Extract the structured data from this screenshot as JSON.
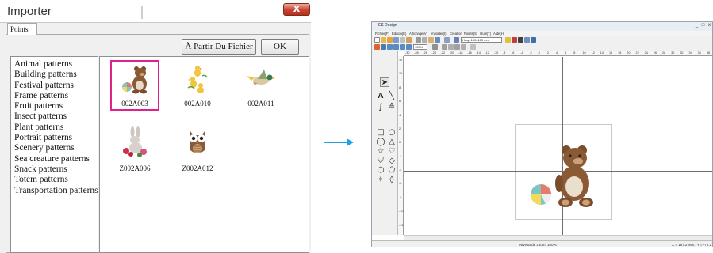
{
  "dialog": {
    "title": "Importer",
    "close_label": "X",
    "tab_label": "Points",
    "from_file_button": "À Partir Du Fichier",
    "ok_button": "OK",
    "categories": [
      "Animal patterns",
      "Building patterns",
      "Festival patterns",
      "Frame patterns",
      "Fruit patterns",
      "Insect patterns",
      "Plant patterns",
      "Portrait patterns",
      "Scenery patterns",
      "Sea creature patterns",
      "Snack patterns",
      "Totem patterns",
      "Transportation patterns"
    ],
    "selected_category": "Animal patterns",
    "patterns": [
      {
        "code": "002A003",
        "icon": "bear-with-ball-icon",
        "selected": true
      },
      {
        "code": "002A010",
        "icon": "ducklings-icon",
        "selected": false
      },
      {
        "code": "002A011",
        "icon": "flying-duck-icon",
        "selected": false
      },
      {
        "code": "Z002A006",
        "icon": "rabbit-with-flowers-icon",
        "selected": false
      },
      {
        "code": "Z002A012",
        "icon": "owl-icon",
        "selected": false
      }
    ],
    "selection_color": "#e0208c"
  },
  "arrow": {
    "icon": "right-arrow-icon",
    "color": "#1aa3e8"
  },
  "app": {
    "title": "ES Design",
    "window_controls": [
      "_",
      "□",
      "x"
    ],
    "menu": [
      "Fichier(F)",
      "Edition(E)",
      "Affichage(V)",
      "Importer(I)",
      "Création",
      "Points(S)",
      "Outil(T)",
      "Aide(H)"
    ],
    "zoom_combo": "100%",
    "hoop_combo": "Hoop 100x100 mm",
    "ruler_top": [
      "-30",
      "-28",
      "-26",
      "-24",
      "-22",
      "-20",
      "-18",
      "-16",
      "-14",
      "-12",
      "-10",
      "-8",
      "-6",
      "-4",
      "-2",
      "0",
      "2",
      "4",
      "6",
      "8",
      "10",
      "12",
      "14",
      "16",
      "18",
      "20",
      "22",
      "24",
      "26",
      "28",
      "30",
      "32",
      "34",
      "36",
      "38"
    ],
    "ruler_left": [
      "12",
      "10",
      "8",
      "6",
      "4",
      "2",
      "0",
      "-2",
      "-4",
      "-6",
      "-8",
      "-10",
      "-12"
    ],
    "status_zoom": "Niveau de zoom: 100%",
    "status_coords": "X = 187.2 mm , Y = -72.2",
    "tools": [
      "select-arrow-icon",
      "text-icon",
      "line-icon",
      "curve-icon",
      "freehand-icon",
      "rectangle-icon",
      "circle-icon",
      "triangle-icon",
      "ellipse-icon",
      "star-icon",
      "heart-icon",
      "shield-icon",
      "diamond-icon",
      "pentagon-shape-icon",
      "hexagon-icon",
      "cross-star-icon",
      "drop-icon"
    ]
  }
}
